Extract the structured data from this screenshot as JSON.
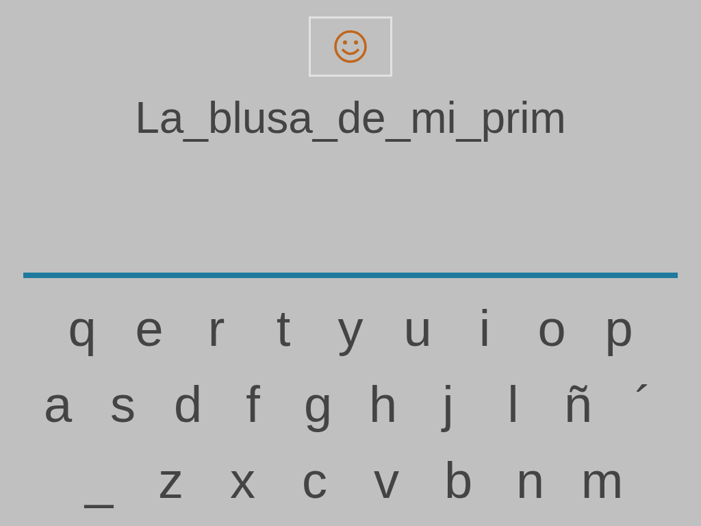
{
  "answer": "La_blusa_de_mi_prim",
  "keyboard": {
    "rows": [
      [
        "q",
        "e",
        "r",
        "t",
        "y",
        "u",
        "i",
        "o",
        "p"
      ],
      [
        "a",
        "s",
        "d",
        "f",
        "g",
        "h",
        "j",
        "l",
        "ñ",
        "´"
      ],
      [
        "_",
        "z",
        "x",
        "c",
        "v",
        "b",
        "n",
        "m"
      ]
    ]
  }
}
